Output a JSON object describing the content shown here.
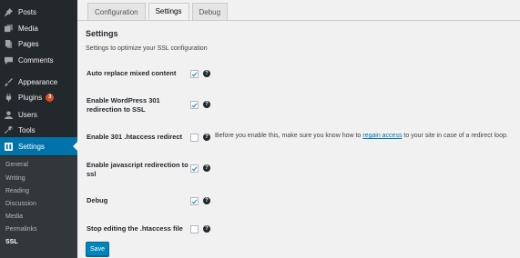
{
  "sidebar": {
    "items": [
      {
        "label": "Posts",
        "icon": "pin-icon"
      },
      {
        "label": "Media",
        "icon": "media-icon"
      },
      {
        "label": "Pages",
        "icon": "pages-icon"
      },
      {
        "label": "Comments",
        "icon": "comment-icon"
      },
      {
        "label": "Appearance",
        "icon": "brush-icon"
      },
      {
        "label": "Plugins",
        "icon": "plug-icon",
        "badge": "3"
      },
      {
        "label": "Users",
        "icon": "user-icon"
      },
      {
        "label": "Tools",
        "icon": "wrench-icon"
      },
      {
        "label": "Settings",
        "icon": "settings-icon",
        "active": true
      }
    ],
    "submenu": [
      "General",
      "Writing",
      "Reading",
      "Discussion",
      "Media",
      "Permalinks",
      "SSL"
    ],
    "current_submenu": "SSL",
    "colors": {
      "bg": "#23282d",
      "active": "#0073aa",
      "submenu_bg": "#32373c",
      "badge": "#d54e21"
    }
  },
  "tabs": [
    "Configuration",
    "Settings",
    "Debug"
  ],
  "active_tab": "Settings",
  "settings": {
    "title": "Settings",
    "description": "Settings to optimize your SSL configuration",
    "rows": [
      {
        "label": "Auto replace mixed content",
        "checked": true
      },
      {
        "label": "Enable WordPress 301 redirection to SSL",
        "checked": true
      },
      {
        "label": "Enable 301 .htaccess redirect",
        "checked": false
      },
      {
        "label": "Enable javascript redirection to ssl",
        "checked": true
      },
      {
        "label": "Debug",
        "checked": true
      },
      {
        "label": "Stop editing the .htaccess file",
        "checked": false
      }
    ],
    "htaccess_note": {
      "before": "Before you enable this, make sure you know how to ",
      "link": "regain access",
      "after": " to your site in case of a redirect loop."
    },
    "help_symbol": "?",
    "save_label": "Save"
  }
}
